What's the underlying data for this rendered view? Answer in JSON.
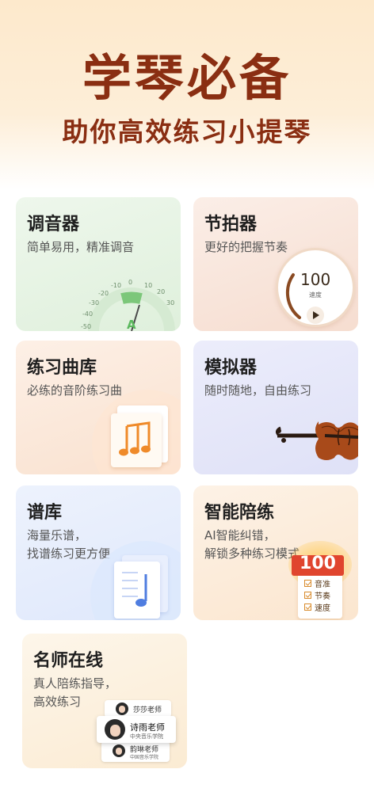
{
  "hero": {
    "title": "学琴必备",
    "subtitle": "助你高效练习小提琴"
  },
  "cards": {
    "tuner": {
      "title": "调音器",
      "desc": "简单易用，精准调音",
      "note": "A",
      "scale_labels": [
        "-50",
        "-40",
        "-30",
        "-20",
        "-10",
        "0",
        "10",
        "20",
        "30"
      ]
    },
    "metronome": {
      "title": "节拍器",
      "desc": "更好的把握节奏",
      "tempo": "100",
      "tempo_label": "速度"
    },
    "library": {
      "title": "练习曲库",
      "desc": "必练的音阶练习曲"
    },
    "simulator": {
      "title": "模拟器",
      "desc": "随时随地，自由练习"
    },
    "score": {
      "title": "谱库",
      "desc_line1": "海量乐谱，",
      "desc_line2": "找谱练习更方便"
    },
    "smart": {
      "title": "智能陪练",
      "desc_line1": "AI智能纠错，",
      "desc_line2": "解锁多种练习模式",
      "score": "100",
      "checks": [
        "音准",
        "节奏",
        "速度"
      ]
    },
    "teacher": {
      "title": "名师在线",
      "desc_line1": "真人陪练指导，",
      "desc_line2": "高效练习",
      "teachers": [
        {
          "name": "莎莎老师",
          "school": ""
        },
        {
          "name": "诗雨老师",
          "school": "中央音乐学院"
        },
        {
          "name": "韵琳老师",
          "school": "中国音乐学院"
        }
      ]
    }
  },
  "colors": {
    "hero_text": "#8a2e12",
    "accent_green": "#5bb85d",
    "accent_orange": "#e07a2a",
    "badge_red": "#e0452e"
  }
}
